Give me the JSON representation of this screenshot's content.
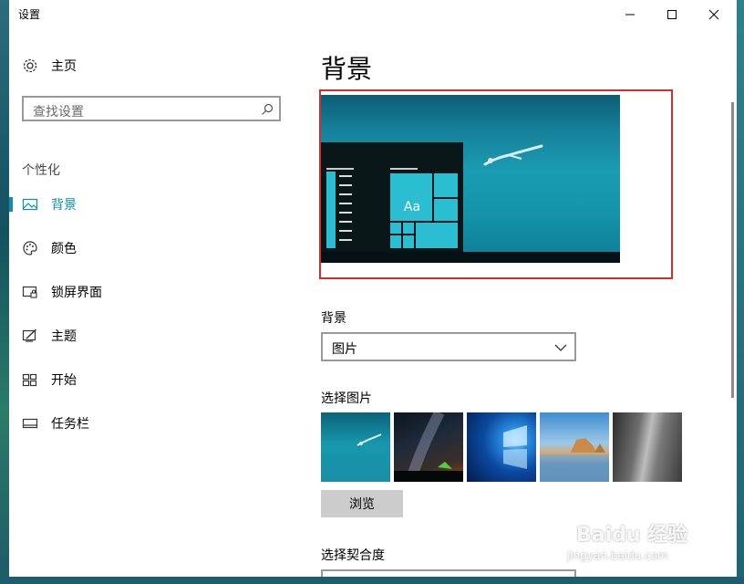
{
  "window": {
    "title": "设置",
    "caption": {
      "minimize": "minimize",
      "maximize": "maximize",
      "close": "close"
    }
  },
  "sidebar": {
    "home": {
      "label": "主页",
      "icon": "gear-icon"
    },
    "search": {
      "placeholder": "查找设置",
      "icon": "search-icon"
    },
    "section": "个性化",
    "items": [
      {
        "label": "背景",
        "icon": "picture-icon",
        "active": true
      },
      {
        "label": "颜色",
        "icon": "palette-icon",
        "active": false
      },
      {
        "label": "锁屏界面",
        "icon": "lock-screen-icon",
        "active": false
      },
      {
        "label": "主题",
        "icon": "theme-icon",
        "active": false
      },
      {
        "label": "开始",
        "icon": "start-icon",
        "active": false
      },
      {
        "label": "任务栏",
        "icon": "taskbar-icon",
        "active": false
      }
    ]
  },
  "main": {
    "title": "背景",
    "preview": {
      "tile_text": "Aa"
    },
    "background": {
      "label": "背景",
      "value": "图片"
    },
    "pick": {
      "label": "选择图片"
    },
    "browse_label": "浏览",
    "fit": {
      "label": "选择契合度"
    }
  },
  "watermark": {
    "brand": "Baidu 经验",
    "url": "jingyan.baidu.com"
  },
  "colors": {
    "accent": "#0f8fa3",
    "highlight": "#d32f2f",
    "tile": "#2bbdd1"
  }
}
